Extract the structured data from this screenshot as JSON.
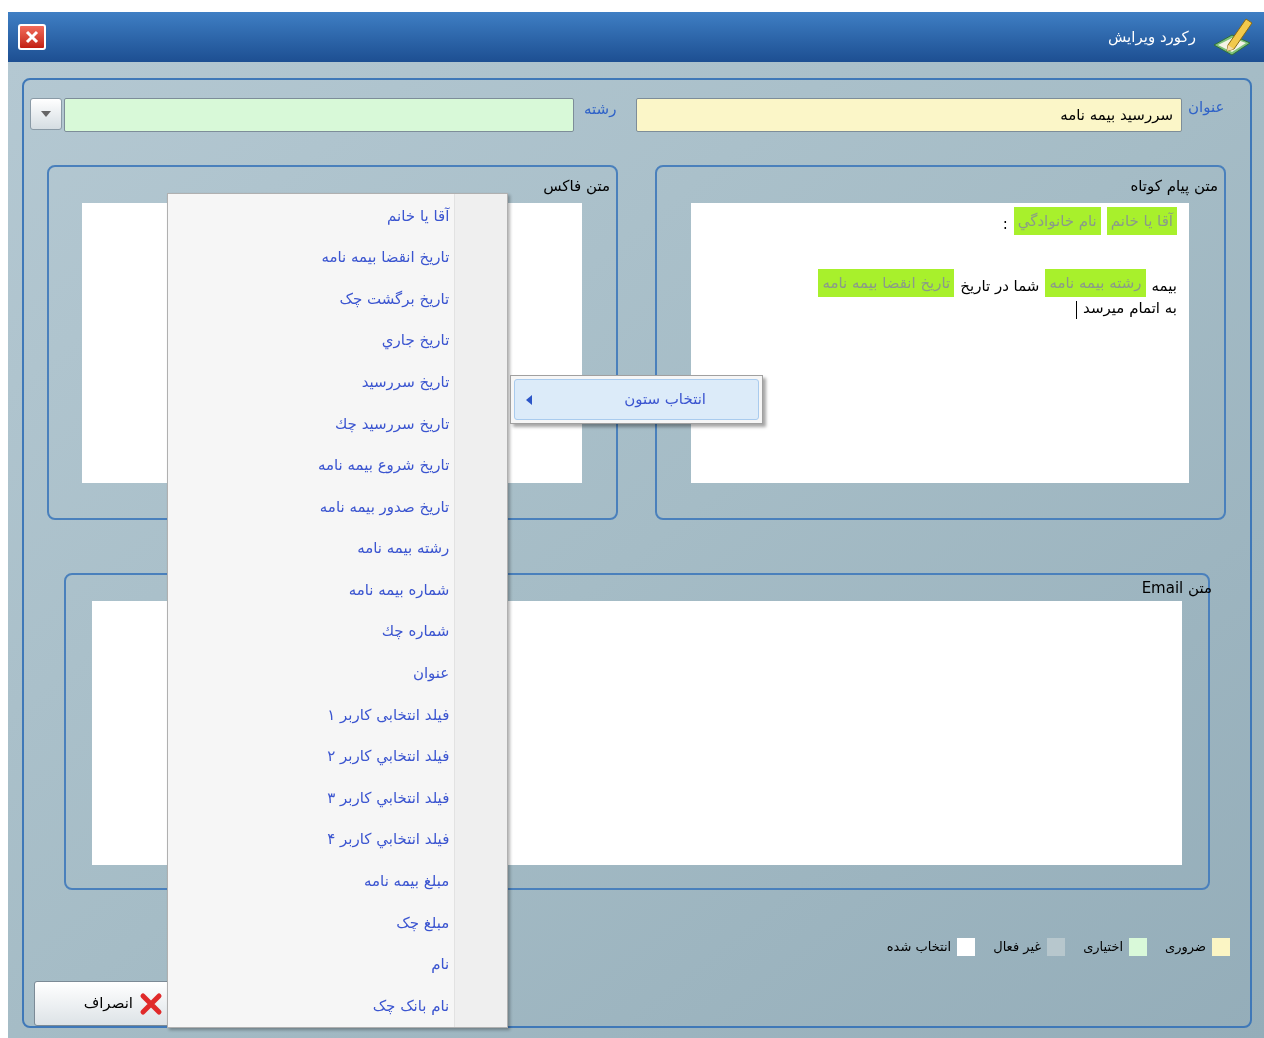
{
  "window": {
    "title": "رکورد ویرایش"
  },
  "fields": [
    {
      "kind": "text",
      "label": "عنوان",
      "value": "سررسید بیمه نامه",
      "color": "#fbf6c8"
    },
    {
      "kind": "dropdown",
      "label": "رشته",
      "color": "#d8f9d8"
    }
  ],
  "sms": {
    "label": "متن پیام کوتاه",
    "lines": [
      [
        {
          "kind": "field",
          "text": "آقا یا خانم"
        },
        {
          "kind": "field",
          "text": "نام خانوادگي"
        },
        {
          "kind": "text",
          "text": ":"
        }
      ],
      [
        {
          "kind": "text",
          "text": "بیمه"
        },
        {
          "kind": "field",
          "text": "رشته بیمه نامه"
        },
        {
          "kind": "text",
          "text": "شما در تاریخ"
        },
        {
          "kind": "field",
          "text": "تاریخ انقضا بیمه نامه"
        }
      ],
      [
        {
          "kind": "text",
          "text": "به اتمام میرسد"
        }
      ]
    ]
  },
  "fax": {
    "label": "متن فاکس"
  },
  "email": {
    "label": "متن Email"
  },
  "legend": [
    {
      "label": "ضروری",
      "color": "#fbf5c4"
    },
    {
      "label": "اختیاری",
      "color": "#d9f9d9"
    },
    {
      "label": "غیر فعال",
      "color": "#b7c7cd"
    },
    {
      "label": "انتخاب شده",
      "color": "#ffffff"
    }
  ],
  "cancel_button": {
    "label": "انصراف"
  },
  "context_menu": {
    "items": [
      "آقا يا خانم",
      "تاريخ انقضا بيمه نامه",
      "تاريخ برگشت چک",
      "تاريخ جاري",
      "تاريخ سررسيد",
      "تاريخ سررسيد چك",
      "تاريخ شروع  بيمه نامه",
      "تاريخ صدور بيمه نامه",
      "رشته بيمه نامه",
      "شماره بيمه نامه",
      "شماره چك",
      "عنوان",
      "فیلد انتخابی کاربر ۱",
      "فيلد انتخابي كاربر ۲",
      "فيلد انتخابي كاربر ۳",
      "فيلد انتخابي كاربر ۴",
      "مبلغ بيمه نامه",
      "مبلغ چک",
      "نام",
      "نام بانک چک"
    ]
  },
  "submenu": {
    "items": [
      {
        "label": "انتخاب ستون",
        "selected": true
      }
    ]
  }
}
